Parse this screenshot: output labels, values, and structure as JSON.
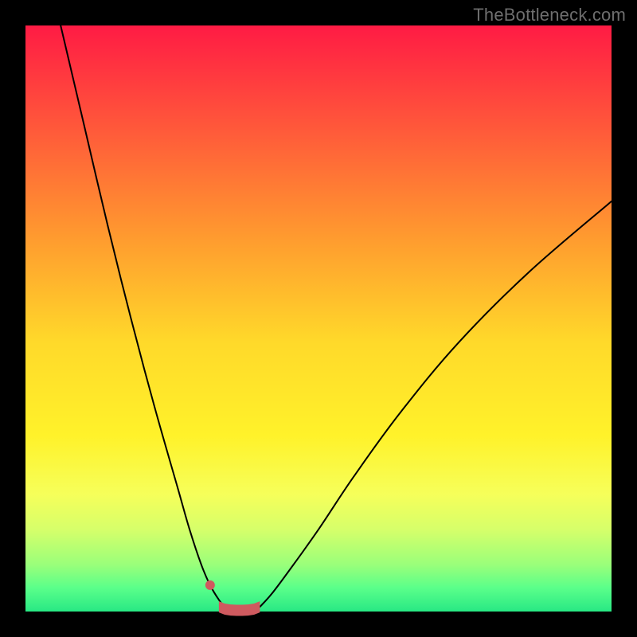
{
  "watermark": "TheBottleneck.com",
  "chart_data": {
    "type": "line",
    "title": "",
    "xlabel": "",
    "ylabel": "",
    "xlim": [
      0,
      100
    ],
    "ylim": [
      0,
      100
    ],
    "grid": false,
    "legend": false,
    "annotations": [],
    "series": [
      {
        "name": "left-curve",
        "x": [
          6,
          10,
          14,
          18,
          22,
          26,
          28,
          30,
          31.5,
          33,
          34
        ],
        "y": [
          100,
          83,
          66,
          50,
          35,
          21,
          14,
          8,
          4.5,
          2,
          0.8
        ]
      },
      {
        "name": "right-curve",
        "x": [
          40,
          42,
          45,
          50,
          56,
          64,
          74,
          86,
          100
        ],
        "y": [
          0.8,
          3,
          7,
          14,
          23,
          34,
          46,
          58,
          70
        ]
      },
      {
        "name": "valley-floor-marker",
        "x": [
          33,
          34,
          35,
          36,
          37,
          38,
          39,
          40
        ],
        "y": [
          0.8,
          0.4,
          0.25,
          0.2,
          0.2,
          0.25,
          0.4,
          0.8
        ]
      },
      {
        "name": "marker-dot",
        "x": [
          31.5
        ],
        "y": [
          4.5
        ]
      }
    ],
    "colors": {
      "curve": "#000000",
      "marker": "#cf5a5f",
      "gradient_top": "#ff1b44",
      "gradient_bottom": "#28e884"
    }
  }
}
